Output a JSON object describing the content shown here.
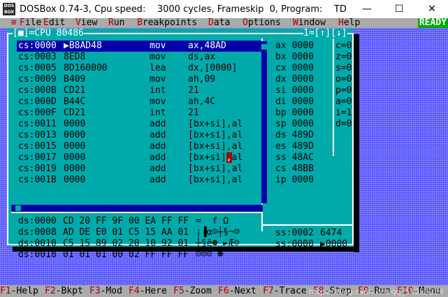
{
  "window": {
    "title": "DOSBox 0.74-3, Cpu speed:    3000 cycles, Frameskip  0, Program:    TD",
    "icon_text": "DOS BOX",
    "minimize": "—",
    "maximize": "☐",
    "close": "✕"
  },
  "menubar": {
    "system": "≡",
    "items": [
      {
        "key": "F",
        "rest": "ile"
      },
      {
        "key": "E",
        "rest": "dit"
      },
      {
        "key": "V",
        "rest": "iew"
      },
      {
        "key": "R",
        "rest": "un"
      },
      {
        "key": "B",
        "rest": "reakpoints"
      },
      {
        "key": "D",
        "rest": "ata"
      },
      {
        "key": "O",
        "rest": "ptions"
      },
      {
        "key": "W",
        "rest": "indow"
      },
      {
        "key": "H",
        "rest": "elp"
      }
    ],
    "status": "READY"
  },
  "cpu_window": {
    "title": "[■]=CPU 80486",
    "title_right": "1=[↑][↓]",
    "code": [
      {
        "addr": "cs:0000",
        "bytes": "▶B8AD48",
        "mnem": "mov",
        "ops": "ax,48AD"
      },
      {
        "addr": "cs:0003",
        "bytes": "8ED8",
        "mnem": "mov",
        "ops": "ds,ax"
      },
      {
        "addr": "cs:0005",
        "bytes": "8D160000",
        "mnem": "lea",
        "ops": "dx,[0000]"
      },
      {
        "addr": "cs:0009",
        "bytes": "B409",
        "mnem": "mov",
        "ops": "ah,09"
      },
      {
        "addr": "cs:000B",
        "bytes": "CD21",
        "mnem": "int",
        "ops": "21"
      },
      {
        "addr": "cs:000D",
        "bytes": "B44C",
        "mnem": "mov",
        "ops": "ah,4C"
      },
      {
        "addr": "cs:000F",
        "bytes": "CD21",
        "mnem": "int",
        "ops": "21"
      },
      {
        "addr": "cs:0011",
        "bytes": "0000",
        "mnem": "add",
        "ops": "[bx+si],al"
      },
      {
        "addr": "cs:0013",
        "bytes": "0000",
        "mnem": "add",
        "ops": "[bx+si],al"
      },
      {
        "addr": "cs:0015",
        "bytes": "0000",
        "mnem": "add",
        "ops": "[bx+si],al"
      },
      {
        "addr": "cs:0017",
        "bytes": "0000",
        "mnem": "add",
        "ops": "[bx+si],al"
      },
      {
        "addr": "cs:0019",
        "bytes": "0000",
        "mnem": "add",
        "ops": "[bx+si],al"
      },
      {
        "addr": "cs:001B",
        "bytes": "0000",
        "mnem": "add",
        "ops": "[bx+si],al"
      }
    ],
    "registers": [
      {
        "name": "ax",
        "value": "0000"
      },
      {
        "name": "bx",
        "value": "0000"
      },
      {
        "name": "cx",
        "value": "0000"
      },
      {
        "name": "dx",
        "value": "0000"
      },
      {
        "name": "si",
        "value": "0000"
      },
      {
        "name": "di",
        "value": "0000"
      },
      {
        "name": "bp",
        "value": "0000"
      },
      {
        "name": "sp",
        "value": "0000"
      },
      {
        "name": "ds",
        "value": "489D"
      },
      {
        "name": "es",
        "value": "489D"
      },
      {
        "name": "ss",
        "value": "48AC"
      },
      {
        "name": "cs",
        "value": "48BB"
      },
      {
        "name": "ip",
        "value": "0000"
      }
    ],
    "flags": [
      "c=0",
      "z=0",
      "s=0",
      "o=0",
      "p=0",
      "a=0",
      "i=1",
      "d=0"
    ],
    "dump": [
      {
        "addr": "ds:0000",
        "bytes": "CD 20 FF 9F 00 EA FF FF",
        "ascii": "=  f Ω"
      },
      {
        "addr": "ds:0008",
        "bytes": "AD DE E0 01 C5 15 AA 01",
        "ascii": "¡▐α☺┼§¬☺"
      },
      {
        "addr": "ds:0010",
        "bytes": "C5 15 89 02 20 10 92 01",
        "ascii": "┼§ë☻ ►Æ☺"
      },
      {
        "addr": "ds:0018",
        "bytes": "01 01 01 00 02 FF FF FF",
        "ascii": "☺☺☺ ☻"
      }
    ],
    "stack": [
      {
        "addr": "ss:0002",
        "value": "6474"
      },
      {
        "addr": "ss:0000",
        "value": "▶0000"
      }
    ]
  },
  "fkeys": [
    {
      "key": "F1",
      "label": "-Help"
    },
    {
      "key": "F2",
      "label": "-Bkpt"
    },
    {
      "key": "F3",
      "label": "-Mod"
    },
    {
      "key": "F4",
      "label": "-Here"
    },
    {
      "key": "F5",
      "label": "-Zoom"
    },
    {
      "key": "F6",
      "label": "-Next"
    },
    {
      "key": "F7",
      "label": "-Trace"
    },
    {
      "key": "F8",
      "label": "-Step"
    },
    {
      "key": "F9",
      "label": "-Run"
    },
    {
      "key": "F10",
      "label": "-Menu"
    }
  ],
  "watermark": "https://blog.csdn.net/qq_51558236"
}
